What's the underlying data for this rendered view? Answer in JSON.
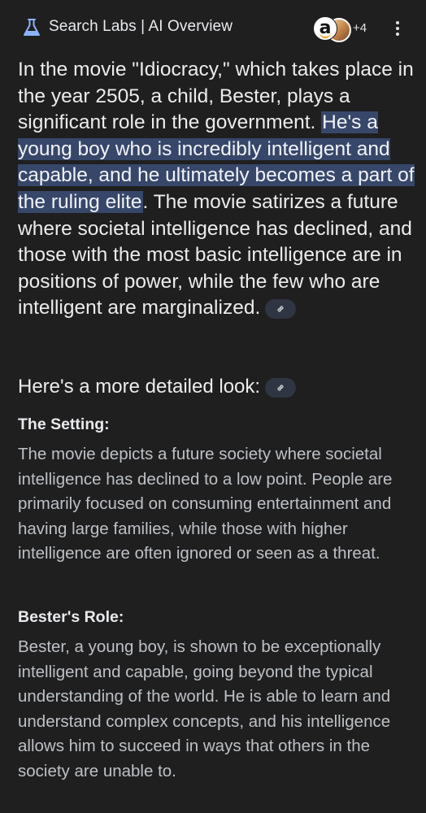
{
  "header": {
    "title": "Search Labs | AI Overview",
    "sources_count": "+4",
    "amazon_glyph": "a",
    "icons": [
      "labs-flask-icon",
      "amazon-logo-icon",
      "more-vert-icon"
    ]
  },
  "overview": {
    "text_before": "In the movie \"Idiocracy,\" which takes place in the year 2505, a child, Bester, plays a significant role in the government.",
    "highlight": "He's a young boy who is incredibly intelligent and capable, and he ultimately becomes a part of the ruling elite",
    "text_after": ". The movie satirizes a future where societal intelligence has declined, and those with the most basic intelligence are in positions of power, while the few who are intelligent are marginalized."
  },
  "details": {
    "heading": "Here's a more detailed look:",
    "sections": [
      {
        "title": "The Setting:",
        "body": "The movie depicts a future society where societal intelligence has declined to a low point. People are primarily focused on consuming entertainment and having large families, while those with higher intelligence are often ignored or seen as a threat."
      },
      {
        "title": "Bester's Role:",
        "body": "Bester, a young boy, is shown to be exceptionally intelligent and capable, going beyond the typical understanding of the world. He is able to learn and understand complex concepts, and his intelligence allows him to succeed in ways that others in the society are unable to."
      }
    ]
  },
  "colors": {
    "background": "#1f1f1f",
    "highlight": "#37476a",
    "link_chip": "#2f3542",
    "body_text": "#bdc1c6",
    "lead_text": "#ececec"
  }
}
